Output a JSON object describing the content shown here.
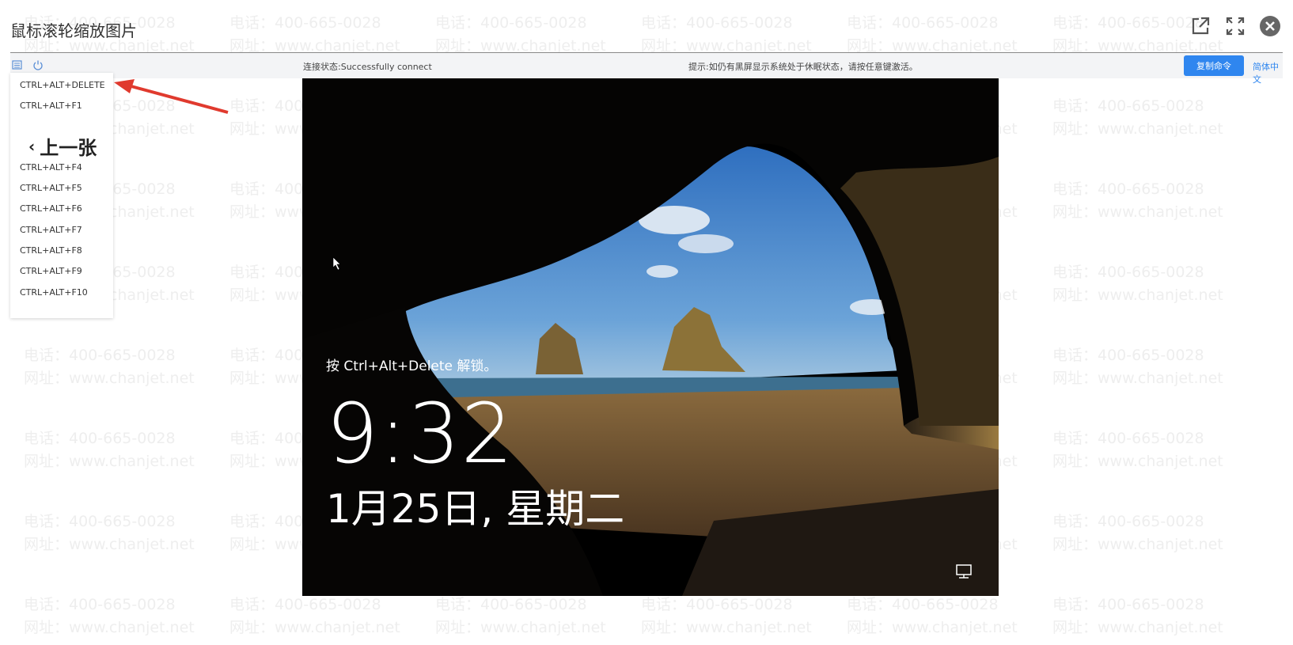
{
  "viewer": {
    "title": "鼠标滚轮缩放图片",
    "prev_label": "上一张",
    "icons": [
      "open-external-icon",
      "fullscreen-icon",
      "close-icon"
    ]
  },
  "watermark": {
    "phone": "电话：400-665-0028",
    "site": "网址：www.chanjet.net",
    "color": "#eeeeee"
  },
  "remote_bar": {
    "status": "连接状态:Successfully connect",
    "hint": "提示:如仍有黑屏显示系统处于休眠状态，请按任意键激活。",
    "copy_button": "复制命令",
    "lang": "简体中文",
    "accent": "#2f86ef"
  },
  "key_menu": {
    "items": [
      "CTRL+ALT+DELETE",
      "CTRL+ALT+F1",
      "CTRL+ALT+F4",
      "CTRL+ALT+F5",
      "CTRL+ALT+F6",
      "CTRL+ALT+F7",
      "CTRL+ALT+F8",
      "CTRL+ALT+F9",
      "CTRL+ALT+F10"
    ]
  },
  "lock_screen": {
    "hint": "按 Ctrl+Alt+Delete 解锁。",
    "time": "9:32",
    "date": "1月25日, 星期二"
  }
}
